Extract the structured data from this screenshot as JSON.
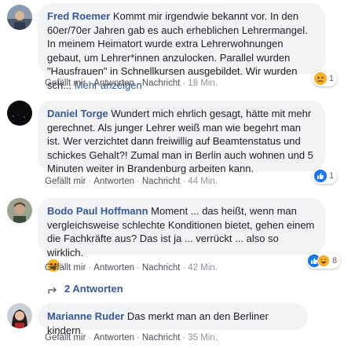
{
  "comments": [
    {
      "author": "Fred Roemer",
      "text": "Kommt mir irgendwie bekannt vor. In den 60er/70er Jahren gab es auch erheblichen Lehrermangel. In meinem Heimatort wurde extra Lehrerwohnungen gebaut, um Lehrer*innen anzulocken. Parallel wurden \"Hausfrauen\" in Schnellkursen ausgebildet. Wir wurden sch...",
      "more": "Mehr anzeigen",
      "like": "Gefällt mir",
      "reply": "Antworten",
      "message": "Nachricht",
      "time": "18 Min.",
      "reaction_count": "1",
      "reaction_icons": [
        "sad-reaction-icon"
      ]
    },
    {
      "author": "Daniel Torge",
      "text": "Wundert mich ehrlich gesagt, hätte mit mehr gerechnet. Als junger Lehrer weiß man wie begehrt man ist. Wer verzichtet dann freiwillig auf Beamtenstatus und schickes Gehalt?! Zumal man in Berlin auch wohnen und 5 Minuten weiter in Brandenburg arbeiten kann.",
      "like": "Gefällt mir",
      "reply": "Antworten",
      "message": "Nachricht",
      "time": "44 Min.",
      "reaction_count": "1",
      "reaction_icons": [
        "like-reaction-icon"
      ]
    },
    {
      "author": "Bodo Paul Hoffmann",
      "text": "Moment ... das heißt, wenn man vergleichsweise schlechte Konditionen bietet, gehen einem die Fachkräfte aus? Das ist ja ... verrückt ... also so wirklich.",
      "like": "Gefällt mir",
      "reply": "Antworten",
      "message": "Nachricht",
      "time": "42 Min.",
      "reaction_count": "8",
      "reaction_icons": [
        "like-reaction-icon",
        "haha-reaction-icon"
      ],
      "replies_label": "2 Antworten"
    },
    {
      "author": "Marianne Ruder",
      "text": "Das merkt man an den Berliner kindern",
      "like": "Gefällt mir",
      "reply": "Antworten",
      "message": "Nachricht",
      "time": "35 Min."
    }
  ],
  "colors": {
    "author": "#385898",
    "bubble": "#f2f3f5",
    "like_blue": "#1877f2",
    "reaction_yellow": "#f7b125"
  }
}
